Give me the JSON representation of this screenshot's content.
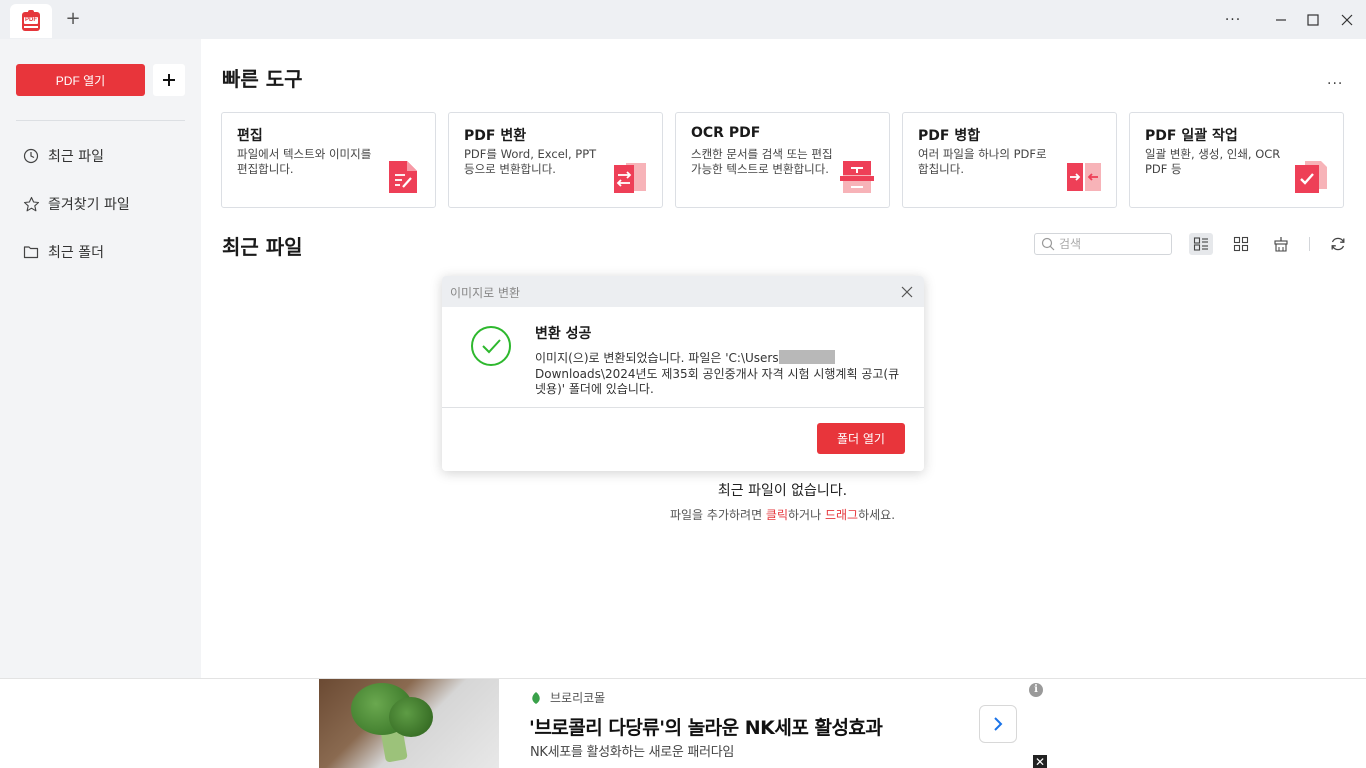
{
  "titlebar": {
    "app_logo_text": "PDF",
    "new_tab_symbol": "+",
    "more_symbol": "···"
  },
  "sidebar": {
    "open_pdf_label": "PDF 열기",
    "add_symbol": "+",
    "items": [
      {
        "label": "최근 파일",
        "icon": "clock-icon"
      },
      {
        "label": "즐겨찾기 파일",
        "icon": "star-icon"
      },
      {
        "label": "최근 폴더",
        "icon": "folder-icon"
      }
    ]
  },
  "quick_tools": {
    "title": "빠른 도구",
    "more_symbol": "···",
    "cards": [
      {
        "title": "편집",
        "desc": "파일에서 텍스트와 이미지를 편집합니다.",
        "icon": "edit-doc-icon"
      },
      {
        "title": "PDF 변환",
        "desc": "PDF를 Word, Excel, PPT 등으로 변환합니다.",
        "icon": "convert-doc-icon"
      },
      {
        "title": "OCR PDF",
        "desc": "스캔한 문서를 검색 또는 편집 가능한 텍스트로 변환합니다.",
        "icon": "ocr-doc-icon"
      },
      {
        "title": "PDF 병합",
        "desc": "여러 파일을 하나의 PDF로 합칩니다.",
        "icon": "merge-doc-icon"
      },
      {
        "title": "PDF 일괄 작업",
        "desc": "일괄 변환, 생성, 인쇄, OCR PDF 등",
        "icon": "batch-doc-icon"
      }
    ]
  },
  "recent": {
    "title": "최근 파일",
    "search_placeholder": "검색",
    "empty_title": "최근 파일이 없습니다.",
    "empty_prefix": "파일을 추가하려면 ",
    "empty_click": "클릭",
    "empty_middle": "하거나 ",
    "empty_drag": "드래그",
    "empty_suffix": "하세요."
  },
  "dialog": {
    "title": "이미지로 변환",
    "heading": "변환 성공",
    "message_part1": "이미지(으)로 변환되었습니다. 파일은 'C:\\Users",
    "message_part2": "Downloads\\2024년도 제35회 공인중개사 자격 시험 시행계획 공고(큐넷용)' 폴더에 있습니다.",
    "button_label": "폴더 열기"
  },
  "ad": {
    "brand": "브로리코몰",
    "headline": "'브로콜리 다당류'의 놀라운 NK세포 활성효과",
    "sub": "NK세포를 활성화하는 새로운 패러다임",
    "info_symbol": "i",
    "close_symbol": "✕"
  },
  "colors": {
    "accent": "#e8353b",
    "success": "#2eb82e",
    "sidebar_bg": "#f3f4f6",
    "titlebar_bg": "#eef0f3"
  }
}
